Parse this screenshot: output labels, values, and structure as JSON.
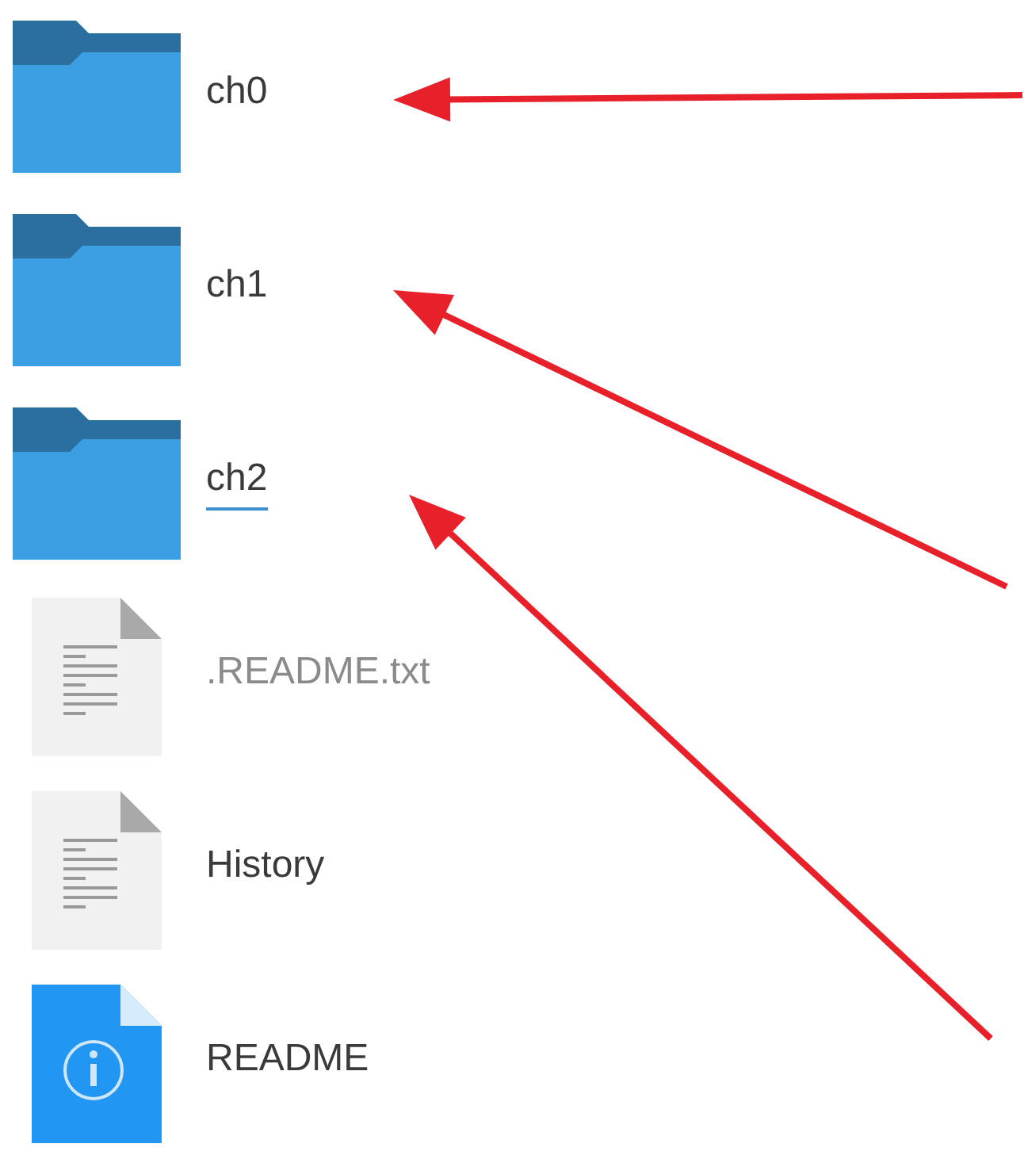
{
  "files": [
    {
      "name": "ch0",
      "kind": "folder",
      "hidden": false,
      "focused": false
    },
    {
      "name": "ch1",
      "kind": "folder",
      "hidden": false,
      "focused": false
    },
    {
      "name": "ch2",
      "kind": "folder",
      "hidden": false,
      "focused": true
    },
    {
      "name": ".README.txt",
      "kind": "text",
      "hidden": true,
      "focused": false
    },
    {
      "name": "History",
      "kind": "text",
      "hidden": false,
      "focused": false
    },
    {
      "name": "README",
      "kind": "info",
      "hidden": false,
      "focused": false
    }
  ],
  "annotations": [
    {
      "kind": "arrow"
    },
    {
      "kind": "arrow"
    },
    {
      "kind": "arrow"
    }
  ]
}
